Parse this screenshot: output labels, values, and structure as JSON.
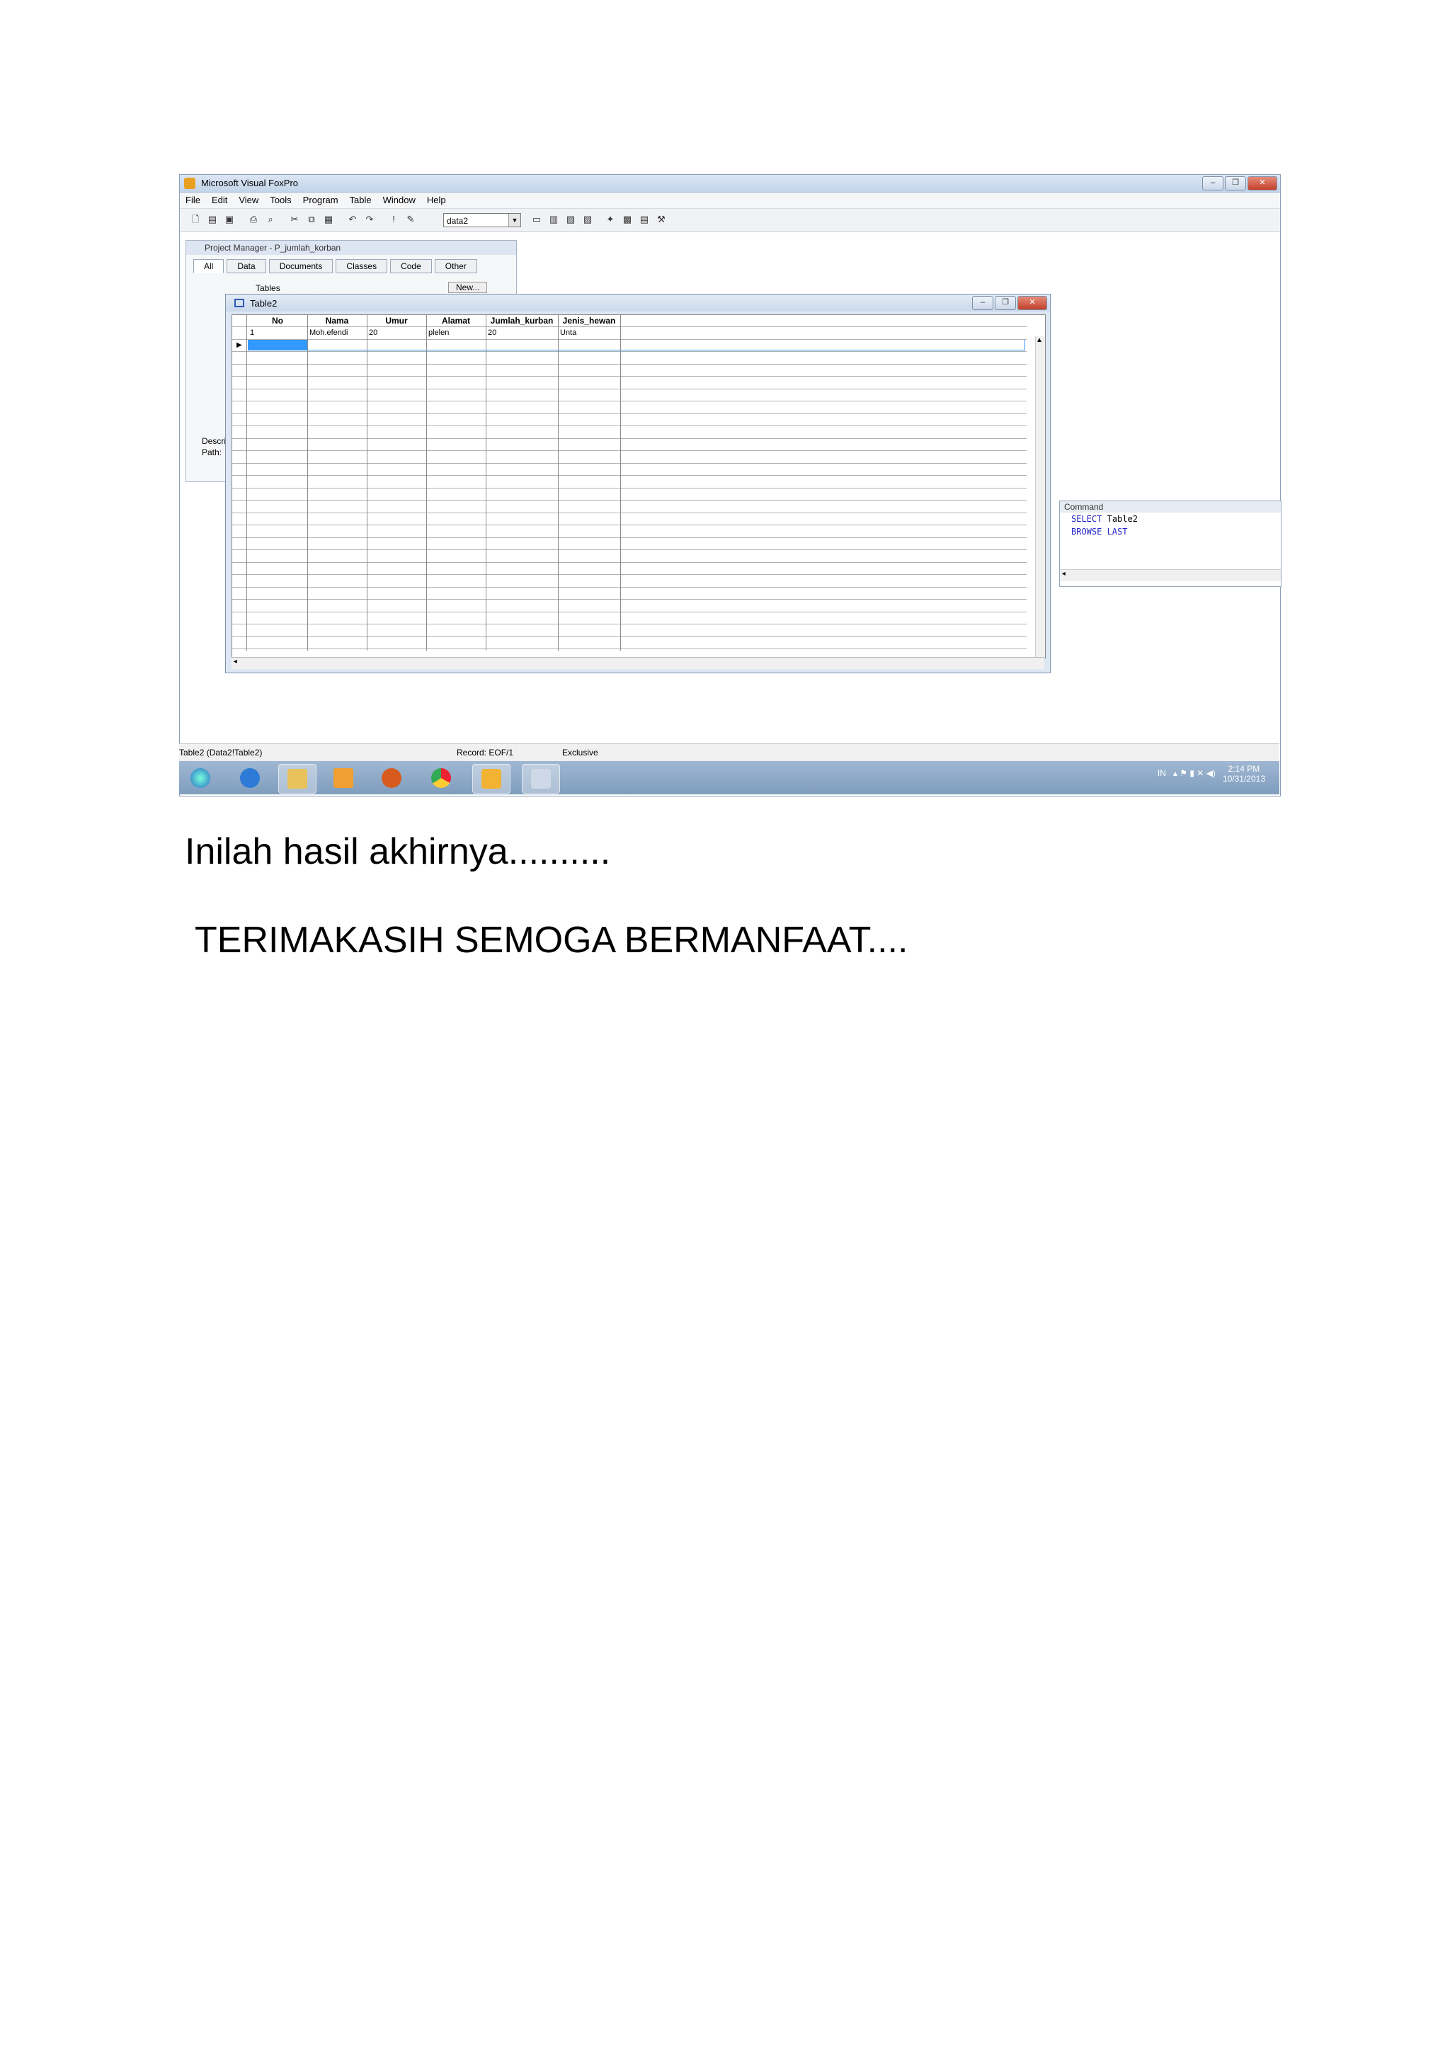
{
  "window": {
    "title": "Microsoft Visual FoxPro",
    "menu": [
      "File",
      "Edit",
      "View",
      "Tools",
      "Program",
      "Table",
      "Window",
      "Help"
    ],
    "database_combo": "data2"
  },
  "project_manager": {
    "title": "Project Manager - P_jumlah_korban",
    "tabs": [
      "All",
      "Data",
      "Documents",
      "Classes",
      "Code",
      "Other"
    ],
    "selected_tab": "All",
    "tree_item": "Tables",
    "new_button": "New...",
    "description_label": "Descri",
    "path_label": "Path:"
  },
  "browse": {
    "title": "Table2",
    "columns": [
      "No",
      "Nama",
      "Umur",
      "Alamat",
      "Jumlah_kurban",
      "Jenis_hewan"
    ],
    "rows": [
      [
        "1",
        "Moh.efendi",
        "20",
        "plelen",
        "20",
        "Unta"
      ]
    ]
  },
  "command": {
    "title": "Command",
    "line1_kw": "SELECT",
    "line1_arg": "Table2",
    "line2": "BROWSE LAST"
  },
  "status": {
    "table": "Table2 (Data2!Table2)",
    "record": "Record: EOF/1",
    "mode": "Exclusive"
  },
  "taskbar": {
    "lang": "IN",
    "time": "2:14 PM",
    "date": "10/31/2013"
  },
  "captions": {
    "line1": "Inilah hasil akhirnya..........",
    "line2": "TERIMAKASIH SEMOGA BERMANFAAT...."
  }
}
